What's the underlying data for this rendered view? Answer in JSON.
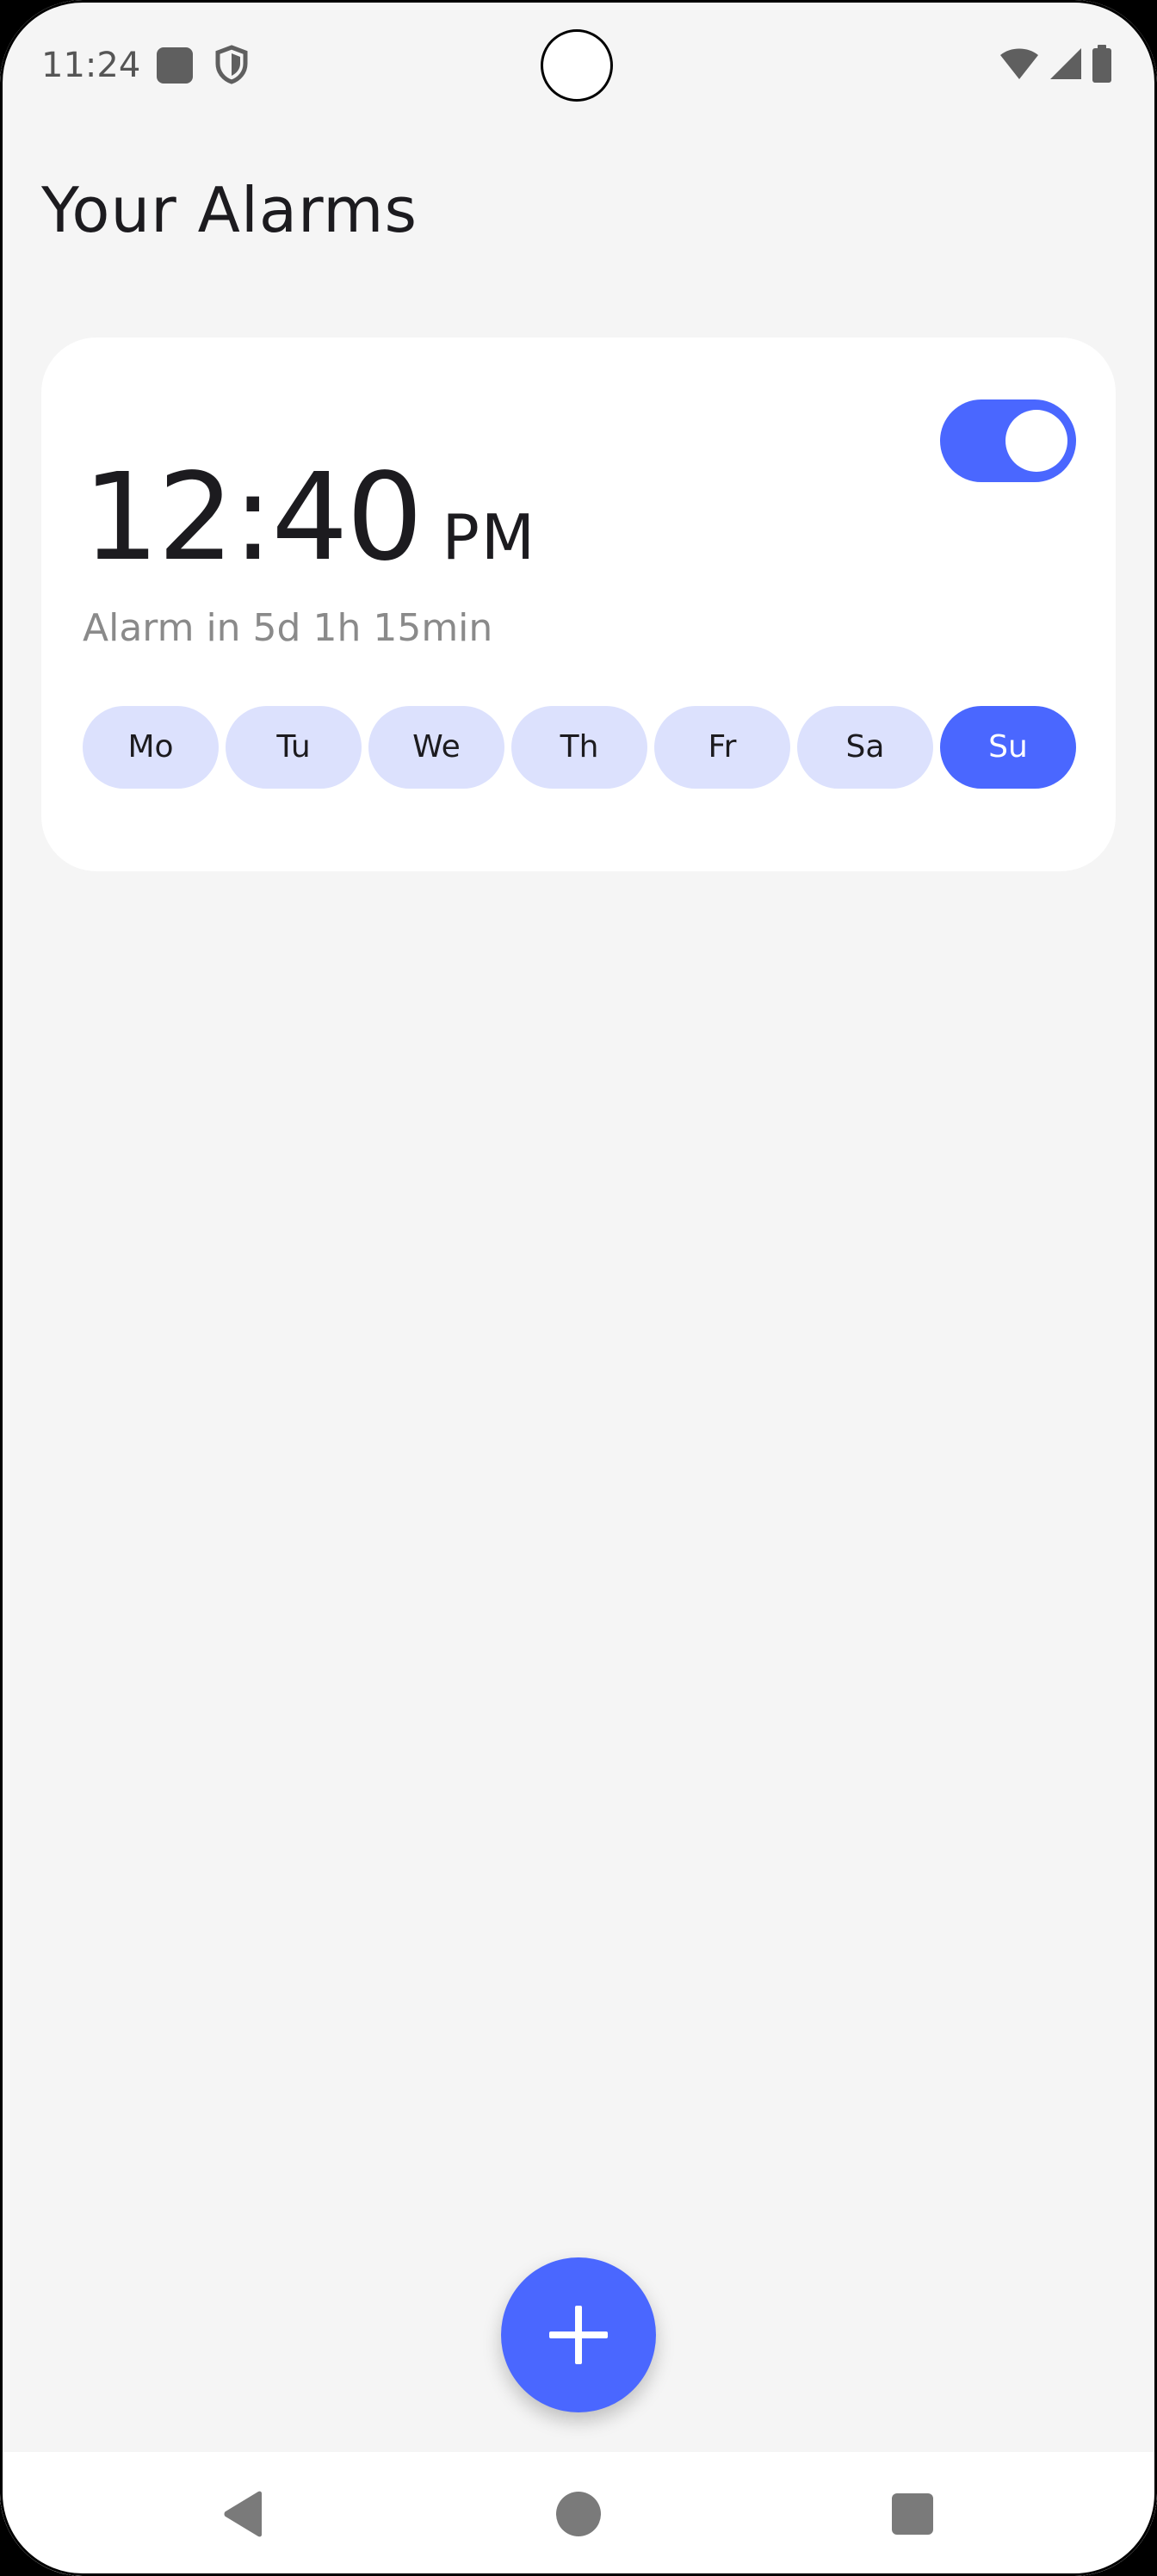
{
  "status_bar": {
    "time": "11:24",
    "left_icons": [
      "app-notification-icon",
      "shield-icon"
    ],
    "right_icons": [
      "wifi-icon",
      "cellular-signal-icon",
      "battery-icon"
    ]
  },
  "header": {
    "title": "Your Alarms"
  },
  "alarms": [
    {
      "time": "12:40",
      "ampm": "PM",
      "countdown": "Alarm in 5d 1h 15min",
      "enabled": true,
      "days": [
        {
          "label": "Mo",
          "active": false
        },
        {
          "label": "Tu",
          "active": false
        },
        {
          "label": "We",
          "active": false
        },
        {
          "label": "Th",
          "active": false
        },
        {
          "label": "Fr",
          "active": false
        },
        {
          "label": "Sa",
          "active": false
        },
        {
          "label": "Su",
          "active": true
        }
      ]
    }
  ],
  "fab": {
    "icon": "plus-icon"
  },
  "nav_bar": {
    "icons": [
      "back-icon",
      "home-icon",
      "recents-icon"
    ]
  },
  "colors": {
    "accent": "#4a67ff",
    "chip_inactive": "#dce1fd",
    "background": "#f5f5f5",
    "card": "#ffffff"
  }
}
